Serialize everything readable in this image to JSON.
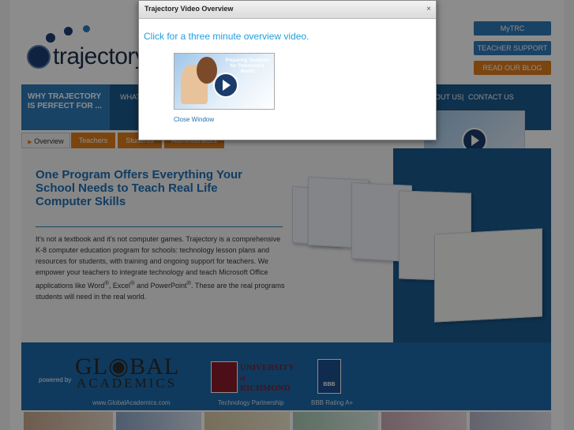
{
  "modal": {
    "title": "Trajectory Video Overview",
    "close_glyph": "×",
    "link": "Click for a three minute overview video.",
    "video_title": "Preparing Students for Tomorrow's World",
    "close_window": "Close Window"
  },
  "header": {
    "logo_text": "trajectory",
    "buttons": [
      {
        "label": "MyTRC",
        "color": "#2f7ab8"
      },
      {
        "label": "TEACHER SUPPORT",
        "color": "#2f7ab8"
      },
      {
        "label": "READ OUR BLOG",
        "color": "#e07f1c"
      }
    ]
  },
  "nav": {
    "why": "WHY TRAJECTORY IS PERFECT FOR ...",
    "partial": "WHAT",
    "about": "OUT US",
    "sep": "|",
    "contact": "CONTACT US"
  },
  "tabs": [
    {
      "label": "Overview",
      "active": true
    },
    {
      "label": "Teachers",
      "active": false
    },
    {
      "label": "Students",
      "active": false
    },
    {
      "label": "Administrators",
      "active": false
    }
  ],
  "main": {
    "headline": "One Program Offers Everything Your School Needs to Teach Real Life Computer Skills",
    "body_1": "It's not a textbook and it's not computer games. Trajectory is a comprehensive K-8 computer education program for schools: technology lesson plans and resources for students, with training and ongoing support for teachers. We empower your teachers to integrate technology and teach Microsoft Office applications like Word",
    "reg": "®",
    "comma": ", Excel",
    "and_pp": " and PowerPoint",
    "body_2": ". These are the real programs students will need in the real world."
  },
  "footer": {
    "powered": "powered by",
    "global_top": "GL◉BAL",
    "global_bottom": "ACADEMICS",
    "global_url": "www.GlobalAcademics.com",
    "ur_line1": "UNIVERSITY",
    "ur_line2": "of",
    "ur_line3": "RICHMOND",
    "ur_caption": "Technology Partnership",
    "bbb_text": "BBB",
    "bbb_caption": "BBB Rating A+"
  },
  "colors": {
    "brand_blue": "#1a5a8f",
    "accent_orange": "#e07f1c",
    "link_blue": "#1ea0e0"
  }
}
